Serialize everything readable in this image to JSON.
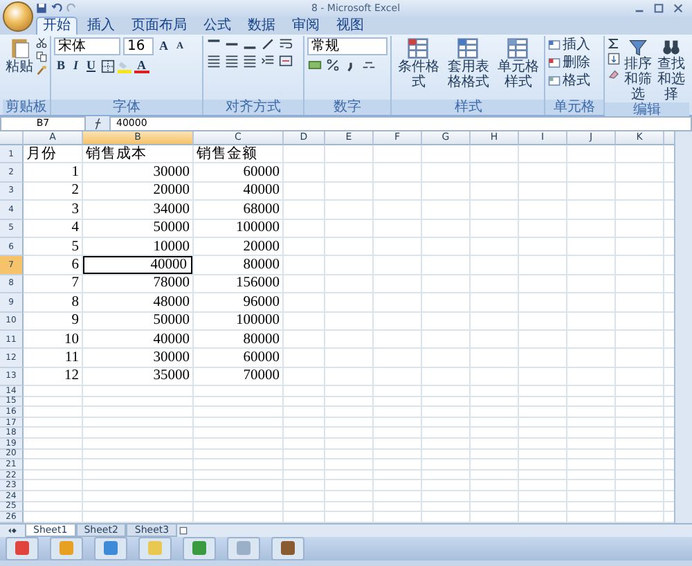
{
  "window": {
    "title": "8 - Microsoft Excel"
  },
  "tabs": [
    {
      "label": "开始",
      "selected": true
    },
    {
      "label": "插入",
      "selected": false
    },
    {
      "label": "页面布局",
      "selected": false
    },
    {
      "label": "公式",
      "selected": false
    },
    {
      "label": "数据",
      "selected": false
    },
    {
      "label": "审阅",
      "selected": false
    },
    {
      "label": "视图",
      "selected": false
    }
  ],
  "ribbon": {
    "clipboard": {
      "paste": "粘贴",
      "label": "剪贴板"
    },
    "font": {
      "name": "宋体",
      "size": "16",
      "grow": "A",
      "shrink": "A",
      "styles": [
        "B",
        "I",
        "U"
      ],
      "color_letter": "A",
      "label": "字体"
    },
    "alignment": {
      "label": "对齐方式"
    },
    "number": {
      "format": "常规",
      "label": "数字"
    },
    "styles": {
      "buttons": [
        "条件格式",
        "套用表格格式",
        "单元格样式"
      ],
      "label": "样式"
    },
    "cells": {
      "buttons": [
        "插入",
        "删除",
        "格式"
      ],
      "label": "单元格"
    },
    "editing": {
      "buttons": [
        "排序和筛选",
        "查找和选择"
      ],
      "label": "编辑"
    }
  },
  "formula_bar": {
    "name_box": "B7",
    "value": "40000"
  },
  "sheet": {
    "columns": [
      {
        "label": "A",
        "selected": false
      },
      {
        "label": "B",
        "selected": true
      },
      {
        "label": "C",
        "selected": false
      },
      {
        "label": "D",
        "selected": false
      },
      {
        "label": "E",
        "selected": false
      },
      {
        "label": "F",
        "selected": false
      },
      {
        "label": "G",
        "selected": false
      },
      {
        "label": "H",
        "selected": false
      },
      {
        "label": "I",
        "selected": false
      },
      {
        "label": "J",
        "selected": false
      },
      {
        "label": "K",
        "selected": false
      }
    ],
    "rows": [
      {
        "number": "1",
        "selected": false,
        "kind": "header",
        "cells": [
          "月份",
          "销售成本",
          "销售金额"
        ]
      },
      {
        "number": "2",
        "selected": false,
        "kind": "data",
        "cells": [
          "1",
          "30000",
          "60000"
        ]
      },
      {
        "number": "3",
        "selected": false,
        "kind": "data",
        "cells": [
          "2",
          "20000",
          "40000"
        ]
      },
      {
        "number": "4",
        "selected": false,
        "kind": "data",
        "cells": [
          "3",
          "34000",
          "68000"
        ]
      },
      {
        "number": "5",
        "selected": false,
        "kind": "data",
        "cells": [
          "4",
          "50000",
          "100000"
        ]
      },
      {
        "number": "6",
        "selected": false,
        "kind": "data",
        "cells": [
          "5",
          "10000",
          "20000"
        ]
      },
      {
        "number": "7",
        "selected": true,
        "kind": "data",
        "cells": [
          "6",
          "40000",
          "80000"
        ]
      },
      {
        "number": "8",
        "selected": false,
        "kind": "data",
        "cells": [
          "7",
          "78000",
          "156000"
        ]
      },
      {
        "number": "9",
        "selected": false,
        "kind": "data",
        "cells": [
          "8",
          "48000",
          "96000"
        ]
      },
      {
        "number": "10",
        "selected": false,
        "kind": "data",
        "cells": [
          "9",
          "50000",
          "100000"
        ]
      },
      {
        "number": "11",
        "selected": false,
        "kind": "data",
        "cells": [
          "10",
          "40000",
          "80000"
        ]
      },
      {
        "number": "12",
        "selected": false,
        "kind": "data",
        "cells": [
          "11",
          "30000",
          "60000"
        ]
      },
      {
        "number": "13",
        "selected": false,
        "kind": "data",
        "cells": [
          "12",
          "35000",
          "70000"
        ]
      },
      {
        "number": "14",
        "selected": false,
        "kind": "empty"
      },
      {
        "number": "15",
        "selected": false,
        "kind": "empty"
      },
      {
        "number": "16",
        "selected": false,
        "kind": "empty"
      },
      {
        "number": "17",
        "selected": false,
        "kind": "empty"
      },
      {
        "number": "18",
        "selected": false,
        "kind": "empty"
      },
      {
        "number": "19",
        "selected": false,
        "kind": "empty"
      },
      {
        "number": "20",
        "selected": false,
        "kind": "empty"
      },
      {
        "number": "21",
        "selected": false,
        "kind": "empty"
      },
      {
        "number": "22",
        "selected": false,
        "kind": "empty"
      },
      {
        "number": "23",
        "selected": false,
        "kind": "empty"
      },
      {
        "number": "24",
        "selected": false,
        "kind": "empty"
      },
      {
        "number": "25",
        "selected": false,
        "kind": "empty"
      },
      {
        "number": "26",
        "selected": false,
        "kind": "empty"
      }
    ]
  },
  "sheet_tabs": [
    {
      "label": "Sheet1",
      "selected": true
    },
    {
      "label": "Sheet2",
      "selected": false
    },
    {
      "label": "Sheet3",
      "selected": false
    }
  ],
  "taskbar": {
    "apps": [
      {
        "color": "#e0443c"
      },
      {
        "color": "#e8a020"
      },
      {
        "color": "#3c8ad8"
      },
      {
        "color": "#e8c850"
      },
      {
        "color": "#3a9a40"
      },
      {
        "color": "#9ab0c8"
      },
      {
        "color": "#8a5a30"
      }
    ]
  }
}
